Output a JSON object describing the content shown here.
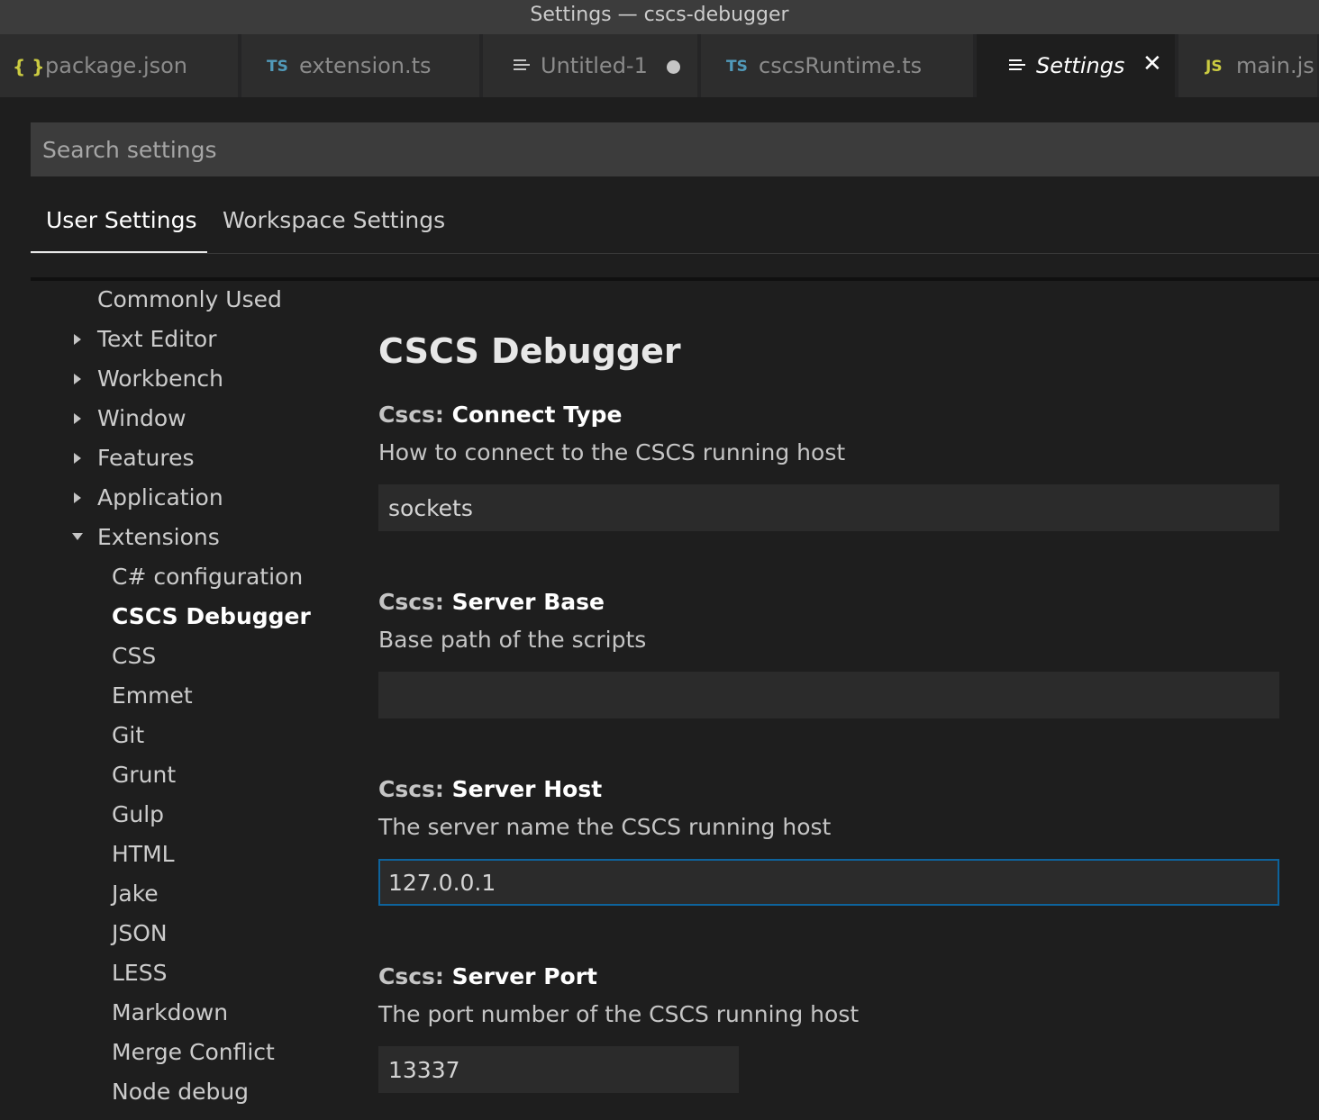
{
  "window": {
    "title": "Settings — cscs-debugger"
  },
  "tabs": [
    {
      "label": "package.json",
      "icon": "json-braces-icon",
      "glyph": "{ }"
    },
    {
      "label": "extension.ts",
      "icon": "typescript-icon",
      "glyph": "TS"
    },
    {
      "label": "Untitled-1",
      "icon": "text-file-icon",
      "dirty": true
    },
    {
      "label": "cscsRuntime.ts",
      "icon": "typescript-icon",
      "glyph": "TS"
    },
    {
      "label": "Settings",
      "icon": "settings-file-icon",
      "active": true,
      "close": "✕"
    },
    {
      "label": "main.js",
      "icon": "javascript-icon",
      "glyph": "JS"
    }
  ],
  "search": {
    "placeholder": "Search settings",
    "value": ""
  },
  "scope_tabs": {
    "user": "User Settings",
    "workspace": "Workspace Settings",
    "active": "user"
  },
  "toc": {
    "items": [
      {
        "label": "Commonly Used",
        "expandable": false
      },
      {
        "label": "Text Editor",
        "expandable": true,
        "expanded": false
      },
      {
        "label": "Workbench",
        "expandable": true,
        "expanded": false
      },
      {
        "label": "Window",
        "expandable": true,
        "expanded": false
      },
      {
        "label": "Features",
        "expandable": true,
        "expanded": false
      },
      {
        "label": "Application",
        "expandable": true,
        "expanded": false
      },
      {
        "label": "Extensions",
        "expandable": true,
        "expanded": true
      }
    ],
    "extensions": [
      "C# configuration",
      "CSCS Debugger",
      "CSS",
      "Emmet",
      "Git",
      "Grunt",
      "Gulp",
      "HTML",
      "Jake",
      "JSON",
      "LESS",
      "Markdown",
      "Merge Conflict",
      "Node debug"
    ],
    "selected": "CSCS Debugger"
  },
  "section": {
    "title": "CSCS Debugger"
  },
  "settings": [
    {
      "category": "Cscs: ",
      "name": "Connect Type",
      "description": "How to connect to the CSCS running host",
      "value": "sockets"
    },
    {
      "category": "Cscs: ",
      "name": "Server Base",
      "description": "Base path of the scripts",
      "value": ""
    },
    {
      "category": "Cscs: ",
      "name": "Server Host",
      "description": "The server name the CSCS running host",
      "value": "127.0.0.1",
      "focused": true
    },
    {
      "category": "Cscs: ",
      "name": "Server Port",
      "description": "The port number of the CSCS running host",
      "value": "13337"
    }
  ],
  "colors": {
    "background": "#1e1e1e",
    "focus_border": "#0e639c",
    "input_background": "#2b2b2b",
    "json_icon": "#cbcb41",
    "ts_icon": "#519aba"
  }
}
